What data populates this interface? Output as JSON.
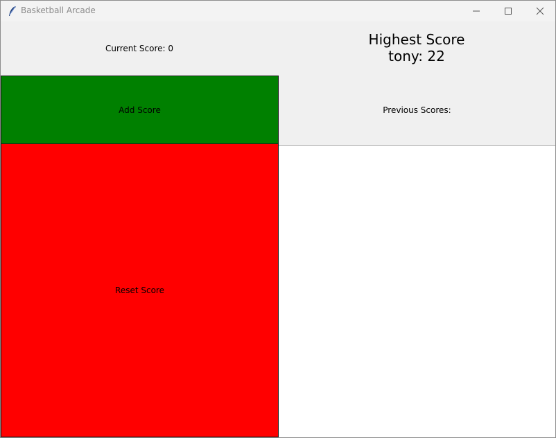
{
  "window": {
    "title": "Basketball Arcade"
  },
  "titlebar_icons": {
    "app": "feather-icon",
    "minimize": "minimize-icon",
    "maximize": "maximize-icon",
    "close": "close-icon"
  },
  "scoreboard": {
    "current_score_label": "Current Score: 0",
    "highest_score_title": "Highest Score",
    "highest_score_value": "tony: 22"
  },
  "controls": {
    "add_label": "Add Score",
    "reset_label": "Reset Score",
    "add_color": "#008000",
    "reset_color": "#ff0000"
  },
  "previous_scores": {
    "label": "Previous Scores:",
    "items": []
  }
}
